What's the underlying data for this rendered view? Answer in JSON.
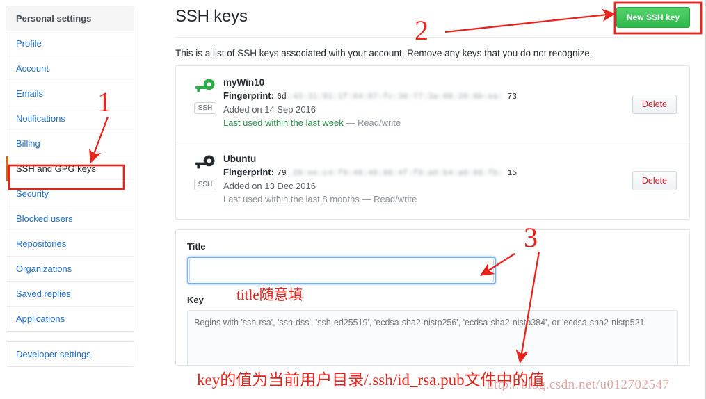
{
  "sidebar": {
    "header": "Personal settings",
    "items": [
      {
        "label": "Profile",
        "active": false
      },
      {
        "label": "Account",
        "active": false
      },
      {
        "label": "Emails",
        "active": false
      },
      {
        "label": "Notifications",
        "active": false
      },
      {
        "label": "Billing",
        "active": false
      },
      {
        "label": "SSH and GPG keys",
        "active": true
      },
      {
        "label": "Security",
        "active": false
      },
      {
        "label": "Blocked users",
        "active": false
      },
      {
        "label": "Repositories",
        "active": false
      },
      {
        "label": "Organizations",
        "active": false
      },
      {
        "label": "Saved replies",
        "active": false
      },
      {
        "label": "Applications",
        "active": false
      }
    ],
    "developer_settings": "Developer settings"
  },
  "main": {
    "title": "SSH keys",
    "new_key_button": "New SSH key",
    "intro": "This is a list of SSH keys associated with your account. Remove any keys that you do not recognize.",
    "keys": [
      {
        "name": "myWin10",
        "fingerprint_label": "Fingerprint:",
        "fingerprint_prefix": "6d",
        "fingerprint_masked": ":43:31:91:1f:04:07:fc:36:77:3a:06:20:6b:ea:",
        "fingerprint_suffix": "73",
        "added": "Added on 14 Sep 2016",
        "last_used": "Last used within the last week",
        "access": " — Read/write",
        "recent": true,
        "badge": "SSH",
        "icon": "key-icon",
        "icon_color": "#2dab47",
        "delete_label": "Delete"
      },
      {
        "name": "Ubuntu",
        "fingerprint_label": "Fingerprint:",
        "fingerprint_prefix": "79",
        "fingerprint_masked": ".20:ee:c4:f9:48:46:66:4f:f9:a0:b4:a0:66:fb:",
        "fingerprint_suffix": "15",
        "added": "Added on 13 Dec 2016",
        "last_used": "Last used within the last 8 months",
        "access": " — Read/write",
        "recent": false,
        "badge": "SSH",
        "icon": "key-icon",
        "icon_color": "#24292e",
        "delete_label": "Delete"
      }
    ],
    "form": {
      "title_label": "Title",
      "title_value": "",
      "title_annotation": "title随意填",
      "key_label": "Key",
      "key_placeholder": "Begins with 'ssh-rsa', 'ssh-dss', 'ssh-ed25519', 'ecdsa-sha2-nistp256', 'ecdsa-sha2-nistp384', or 'ecdsa-sha2-nistp521'",
      "key_value": ""
    }
  },
  "annotations": {
    "num1": "1",
    "num2": "2",
    "num3": "3",
    "key_note": "key的值为当前用户目录/.ssh/id_rsa.pub文件中的值",
    "watermark": "http://blog.csdn.net/u012702547",
    "accent_red": "#e8231c"
  }
}
